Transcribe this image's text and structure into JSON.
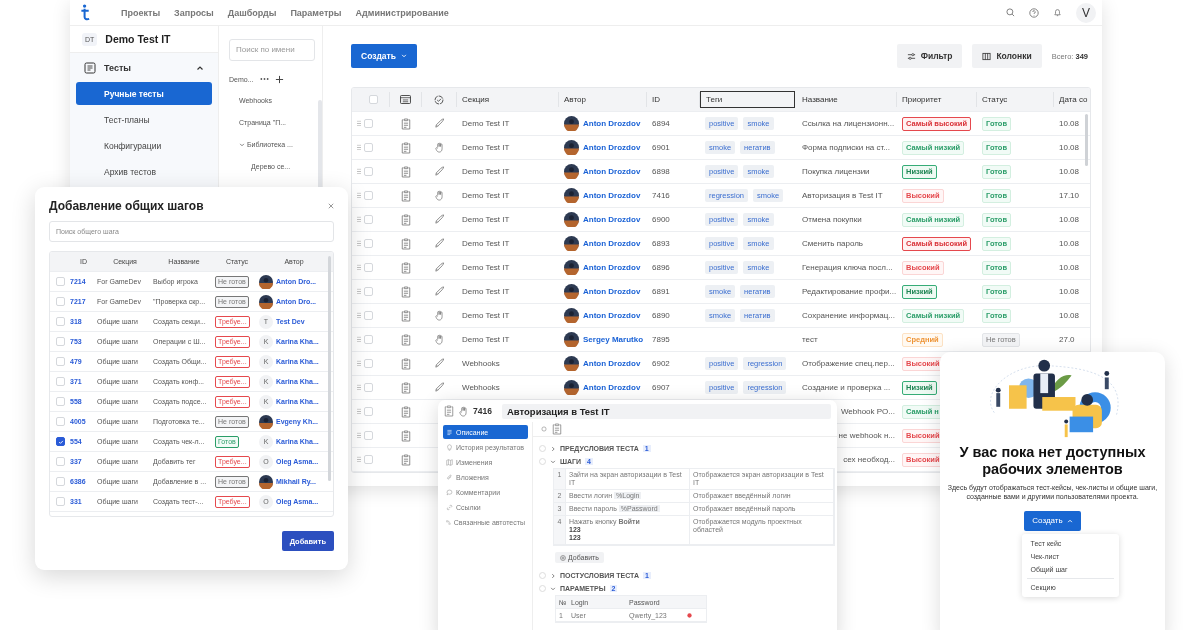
{
  "topbar": {
    "nav": [
      {
        "label": "Проекты"
      },
      {
        "label": "Запросы"
      },
      {
        "label": "Дашборды"
      },
      {
        "label": "Параметры"
      },
      {
        "label": "Администрирование"
      }
    ],
    "avatar": "V"
  },
  "project": {
    "badge": "DT",
    "name": "Demo Test IT"
  },
  "sidebar": {
    "group": {
      "label": "Тесты",
      "expanded": true
    },
    "items": [
      {
        "label": "Ручные тесты",
        "selected": true
      },
      {
        "label": "Тест-планы",
        "selected": false
      },
      {
        "label": "Конфигурации",
        "selected": false
      },
      {
        "label": "Архив тестов",
        "selected": false
      }
    ]
  },
  "tree": {
    "placeholder": "Поиск по имени",
    "root": {
      "label": "Demo...",
      "children": [
        {
          "label": "Webhooks"
        },
        {
          "label": "Страница \"П..."
        },
        {
          "label": "Библиотека ...",
          "expanded": true,
          "children": [
            {
              "label": "Дерево се..."
            }
          ]
        }
      ]
    }
  },
  "toolbar": {
    "create": "Создать",
    "filter": "Фильтр",
    "columns": "Колонки",
    "total": "Всего: **349**"
  },
  "table": {
    "select_all": false,
    "columns": [
      {
        "label": "Секция",
        "focused": false
      },
      {
        "label": "Автор",
        "focused": false
      },
      {
        "label": "ID",
        "focused": false
      },
      {
        "label": "Теги",
        "focused": true
      },
      {
        "label": "Название",
        "focused": false
      },
      {
        "label": "Приоритет",
        "focused": false
      },
      {
        "label": "Статус",
        "focused": false
      },
      {
        "label": "Дата со",
        "focused": false
      }
    ],
    "rows": [
      {
        "checked": false,
        "kind": "auto",
        "section": "Demo Test IT",
        "author": "Anton Drozdov",
        "id": "6894",
        "tags": [
          "positive",
          "smoke"
        ],
        "name": "Ссылка на лицензионн...",
        "priority": {
          "label": "Самый высокий",
          "kind": "highest"
        },
        "status": {
          "label": "Готов",
          "kind": "ready"
        },
        "date": "10.08"
      },
      {
        "checked": false,
        "kind": "manual",
        "section": "Demo Test IT",
        "author": "Anton Drozdov",
        "id": "6901",
        "tags": [
          "smoke",
          "негатив"
        ],
        "name": "Форма подписки на ст...",
        "priority": {
          "label": "Самый низкий",
          "kind": "lowest"
        },
        "status": {
          "label": "Готов",
          "kind": "ready"
        },
        "date": "10.08"
      },
      {
        "checked": false,
        "kind": "auto",
        "section": "Demo Test IT",
        "author": "Anton Drozdov",
        "id": "6898",
        "tags": [
          "positive",
          "smoke"
        ],
        "name": "Покупка лицензии",
        "priority": {
          "label": "Низкий",
          "kind": "low"
        },
        "status": {
          "label": "Готов",
          "kind": "ready"
        },
        "date": "10.08"
      },
      {
        "checked": false,
        "kind": "manual",
        "section": "Demo Test IT",
        "author": "Anton Drozdov",
        "id": "7416",
        "tags": [
          "regression",
          "smoke"
        ],
        "name": "Авторизация в Test IT",
        "priority": {
          "label": "Высокий",
          "kind": "high"
        },
        "status": {
          "label": "Готов",
          "kind": "ready"
        },
        "date": "17.10"
      },
      {
        "checked": false,
        "kind": "auto",
        "section": "Demo Test IT",
        "author": "Anton Drozdov",
        "id": "6900",
        "tags": [
          "positive",
          "smoke"
        ],
        "name": "Отмена покупки",
        "priority": {
          "label": "Самый низкий",
          "kind": "lowest"
        },
        "status": {
          "label": "Готов",
          "kind": "ready"
        },
        "date": "10.08"
      },
      {
        "checked": false,
        "kind": "auto",
        "section": "Demo Test IT",
        "author": "Anton Drozdov",
        "id": "6893",
        "tags": [
          "positive",
          "smoke"
        ],
        "name": "Сменить пароль",
        "priority": {
          "label": "Самый высокий",
          "kind": "highest"
        },
        "status": {
          "label": "Готов",
          "kind": "ready"
        },
        "date": "10.08"
      },
      {
        "checked": false,
        "kind": "auto",
        "section": "Demo Test IT",
        "author": "Anton Drozdov",
        "id": "6896",
        "tags": [
          "positive",
          "smoke"
        ],
        "name": "Генерация ключа посл...",
        "priority": {
          "label": "Высокий",
          "kind": "high"
        },
        "status": {
          "label": "Готов",
          "kind": "ready"
        },
        "date": "10.08"
      },
      {
        "checked": false,
        "kind": "auto",
        "section": "Demo Test IT",
        "author": "Anton Drozdov",
        "id": "6891",
        "tags": [
          "smoke",
          "негатив"
        ],
        "name": "Редактирование профи...",
        "priority": {
          "label": "Низкий",
          "kind": "low"
        },
        "status": {
          "label": "Готов",
          "kind": "ready"
        },
        "date": "10.08"
      },
      {
        "checked": false,
        "kind": "manual",
        "section": "Demo Test IT",
        "author": "Anton Drozdov",
        "id": "6890",
        "tags": [
          "smoke",
          "негатив"
        ],
        "name": "Сохранение информац...",
        "priority": {
          "label": "Самый низкий",
          "kind": "lowest"
        },
        "status": {
          "label": "Готов",
          "kind": "ready"
        },
        "date": "10.08"
      },
      {
        "checked": false,
        "kind": "manual",
        "section": "Demo Test IT",
        "author": "Sergey Marutko",
        "id": "7895",
        "name": "тест",
        "priority": {
          "label": "Средний",
          "kind": "medium"
        },
        "status": {
          "label": "Не готов",
          "kind": "not_ready"
        },
        "date": "27.0"
      },
      {
        "checked": false,
        "kind": "auto",
        "section": "Webhooks",
        "author": "Anton Drozdov",
        "id": "6902",
        "tags": [
          "positive",
          "regression"
        ],
        "name": "Отображение спец.пер...",
        "priority": {
          "label": "Высокий",
          "kind": "high"
        }
      },
      {
        "checked": false,
        "kind": "auto",
        "section": "Webhooks",
        "author": "Anton Drozdov",
        "id": "6907",
        "tags": [
          "positive",
          "regression"
        ],
        "name": "Создание и проверка ...",
        "priority": {
          "label": "Низкий",
          "kind": "low"
        }
      },
      {
        "checked": false,
        "name": "Webhook PO...",
        "priority": {
          "label": "Самый н",
          "kind": "lowest"
        }
      },
      {
        "checked": false,
        "name": "не webhook н...",
        "priority": {
          "label": "Высокий",
          "kind": "high"
        }
      },
      {
        "checked": false,
        "name": "сех необход...",
        "priority": {
          "label": "Высокий",
          "kind": "high"
        }
      }
    ]
  },
  "steps_dialog": {
    "title": "Добавление общих шагов",
    "search_placeholder": "Поиск общего шага",
    "columns": [
      "ID",
      "Секция",
      "Название",
      "Статус",
      "Автор"
    ],
    "rows": [
      {
        "checked": false,
        "id": "7214",
        "section": "For GameDev",
        "name": "Выбор игрока",
        "status": {
          "label": "Не готов",
          "kind": "not_ready"
        },
        "author": "Anton Dro..."
      },
      {
        "checked": false,
        "id": "7217",
        "section": "For GameDev",
        "name": "\"Проверка скр...",
        "status": {
          "label": "Не готов",
          "kind": "not_ready"
        },
        "author": "Anton Dro..."
      },
      {
        "checked": false,
        "id": "318",
        "section": "Общие шаги",
        "name": "Создать секци...",
        "status": {
          "label": "Требуе...",
          "kind": "required"
        },
        "initial": "T",
        "author": "Test Dev"
      },
      {
        "checked": false,
        "id": "753",
        "section": "Общие шаги",
        "name": "Операции с Ш...",
        "status": {
          "label": "Требуе...",
          "kind": "required"
        },
        "initial": "K",
        "author": "Karina Kha..."
      },
      {
        "checked": false,
        "id": "479",
        "section": "Общие шаги",
        "name": "Создать Общи...",
        "status": {
          "label": "Требуе...",
          "kind": "required"
        },
        "initial": "K",
        "author": "Karina Kha..."
      },
      {
        "checked": false,
        "id": "371",
        "section": "Общие шаги",
        "name": "Создать конф...",
        "status": {
          "label": "Требуе...",
          "kind": "required"
        },
        "initial": "K",
        "author": "Karina Kha..."
      },
      {
        "checked": false,
        "id": "558",
        "section": "Общие шаги",
        "name": "Создать подсе...",
        "status": {
          "label": "Требуе...",
          "kind": "required"
        },
        "initial": "K",
        "author": "Karina Kha..."
      },
      {
        "checked": false,
        "id": "4005",
        "section": "Общие шаги",
        "name": "Подготовка те...",
        "status": {
          "label": "Не готов",
          "kind": "not_ready"
        },
        "author": "Evgeny Kh..."
      },
      {
        "checked": true,
        "id": "554",
        "section": "Общие шаги",
        "name": "Создать чек-л...",
        "status": {
          "label": "Готов",
          "kind": "ready"
        },
        "initial": "K",
        "author": "Karina Kha..."
      },
      {
        "checked": false,
        "id": "337",
        "section": "Общие шаги",
        "name": "Добавить тег",
        "status": {
          "label": "Требуе...",
          "kind": "required"
        },
        "initial": "O",
        "author": "Oleg Asma..."
      },
      {
        "checked": false,
        "id": "6386",
        "section": "Общие шаги",
        "name": "Добавление в ...",
        "status": {
          "label": "Не готов",
          "kind": "not_ready"
        },
        "author": "Mikhail Ry..."
      },
      {
        "checked": false,
        "id": "331",
        "section": "Общие шаги",
        "name": "Создать тест-...",
        "status": {
          "label": "Требуе...",
          "kind": "required"
        },
        "initial": "O",
        "author": "Oleg Asma..."
      }
    ],
    "button": "Добавить"
  },
  "test_case": {
    "id": "7416",
    "title": "Авторизация в Test IT",
    "nav": [
      {
        "label": "Описание",
        "selected": true
      },
      {
        "label": "История результатов",
        "selected": false
      },
      {
        "label": "Изменения",
        "selected": false
      },
      {
        "label": "Вложения",
        "selected": false
      },
      {
        "label": "Комментарии",
        "selected": false
      },
      {
        "label": "Ссылки",
        "selected": false
      },
      {
        "label": "Связанные автотесты",
        "selected": false
      }
    ],
    "preconditions": {
      "label": "ПРЕДУСЛОВИЯ ТЕСТА",
      "count": "1",
      "expanded": false
    },
    "steps": {
      "label": "ШАГИ",
      "count": "4",
      "expanded": true,
      "items": [
        {
          "number": "1",
          "action": "Зайти на экран авторизации в Test IT",
          "expected": "Отображается экран авторизации в Test IT"
        },
        {
          "number": "2",
          "action": "Ввести логин",
          "param": "%Login",
          "expected": "Отображает введённый логин"
        },
        {
          "number": "3",
          "action": "Ввести пароль",
          "param": "%Password",
          "expected": "Отображает введённый пароль"
        },
        {
          "number": "4",
          "action": "Нажать кнопку **Войти**",
          "extra": [
            "123",
            "123"
          ],
          "expected": "Отображается модуль проектных областей"
        }
      ]
    },
    "add_button": "Добавить",
    "postconditions": {
      "label": "ПОСТУСЛОВИЯ ТЕСТА",
      "count": "1",
      "expanded": false
    },
    "parameters": {
      "label": "ПАРАМЕТРЫ",
      "count": "2",
      "expanded": true,
      "columns": [
        "№",
        "Login",
        "Password"
      ],
      "rows": [
        {
          "number": "1",
          "login": "User",
          "password": "Qwerty_123"
        }
      ]
    }
  },
  "empty_state": {
    "title": "У вас пока нет доступных рабочих элементов",
    "text": "Здесь будут отображаться тест-кейсы, чек-листы и общие шаги, созданные вами и другими пользователями проекта.",
    "button": "Создать",
    "menu_open": true,
    "menu": [
      {
        "label": "Тест кейс",
        "kind": "item"
      },
      {
        "label": "Чек-лист",
        "kind": "item"
      },
      {
        "label": "Общий шаг",
        "kind": "item"
      },
      {
        "kind": "divider"
      },
      {
        "label": "Секцию",
        "kind": "item"
      }
    ]
  }
}
